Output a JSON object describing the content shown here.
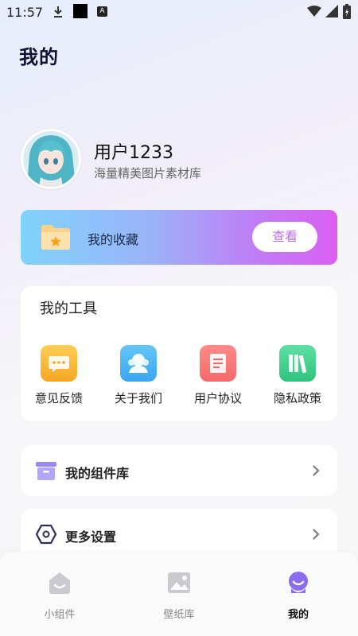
{
  "status_bar": {
    "time": "11:57",
    "badge_letter": "A"
  },
  "page_title": "我的",
  "profile": {
    "username": "用户1233",
    "subtitle": "海量精美图片素材库"
  },
  "favorites": {
    "label": "我的收藏",
    "button": "查看"
  },
  "tools": {
    "title": "我的工具",
    "items": [
      {
        "label": "意见反馈",
        "icon": "feedback-icon"
      },
      {
        "label": "关于我们",
        "icon": "about-icon"
      },
      {
        "label": "用户协议",
        "icon": "agreement-icon"
      },
      {
        "label": "隐私政策",
        "icon": "privacy-icon"
      }
    ]
  },
  "list": [
    {
      "label": "我的组件库",
      "icon": "widget-library-icon"
    },
    {
      "label": "更多设置",
      "icon": "settings-icon"
    }
  ],
  "nav": [
    {
      "label": "小组件",
      "icon": "home-icon"
    },
    {
      "label": "壁纸库",
      "icon": "image-icon"
    },
    {
      "label": "我的",
      "icon": "profile-icon"
    }
  ],
  "colors": {
    "accent_purple": "#8a6cf0",
    "banner_start": "#7fd3fb",
    "banner_end": "#db5ff1"
  }
}
